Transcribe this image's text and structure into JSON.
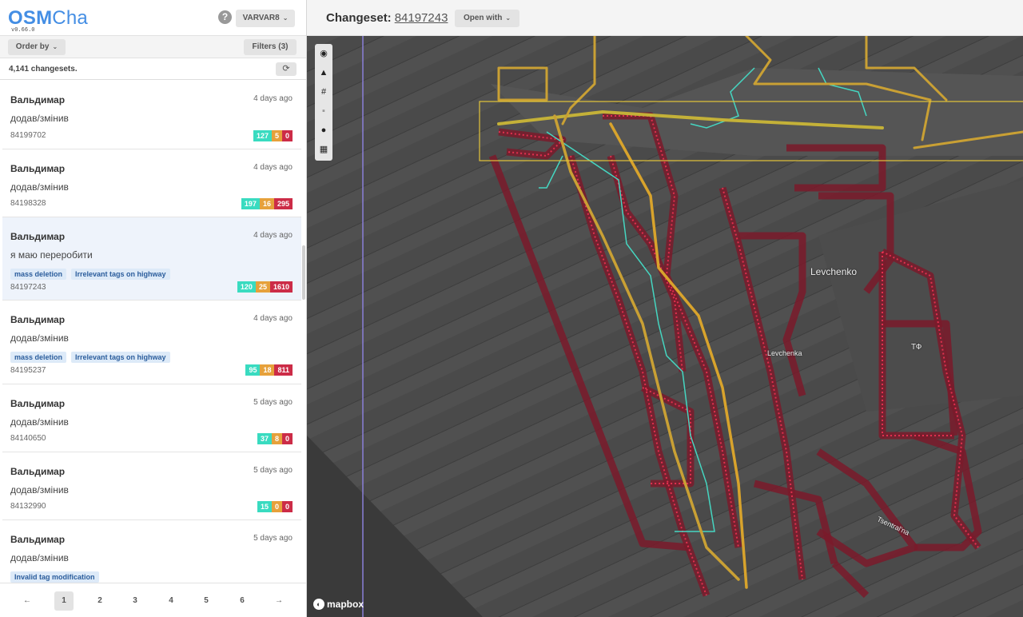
{
  "app": {
    "logo_bold": "OSM",
    "logo_rest": "Cha",
    "version": "v0.66.0",
    "user_button": "VARVAR8"
  },
  "toolbar": {
    "order_by": "Order by",
    "filters": "Filters (3)"
  },
  "list": {
    "count": "4,141 changesets.",
    "items": [
      {
        "user": "Вальдимар",
        "time": "4 days ago",
        "comment": "додав/змінив",
        "tags": [],
        "id": "84199702",
        "added": "127",
        "modified": "5",
        "deleted": "0"
      },
      {
        "user": "Вальдимар",
        "time": "4 days ago",
        "comment": "додав/змінив",
        "tags": [],
        "id": "84198328",
        "added": "197",
        "modified": "16",
        "deleted": "295"
      },
      {
        "user": "Вальдимар",
        "time": "4 days ago",
        "comment": "я маю переробити",
        "tags": [
          "mass deletion",
          "Irrelevant tags on highway"
        ],
        "id": "84197243",
        "added": "120",
        "modified": "25",
        "deleted": "1610"
      },
      {
        "user": "Вальдимар",
        "time": "4 days ago",
        "comment": "додав/змінив",
        "tags": [
          "mass deletion",
          "Irrelevant tags on highway"
        ],
        "id": "84195237",
        "added": "95",
        "modified": "18",
        "deleted": "811"
      },
      {
        "user": "Вальдимар",
        "time": "5 days ago",
        "comment": "додав/змінив",
        "tags": [],
        "id": "84140650",
        "added": "37",
        "modified": "8",
        "deleted": "0"
      },
      {
        "user": "Вальдимар",
        "time": "5 days ago",
        "comment": "додав/змінив",
        "tags": [],
        "id": "84132990",
        "added": "15",
        "modified": "0",
        "deleted": "0"
      },
      {
        "user": "Вальдимар",
        "time": "5 days ago",
        "comment": "додав/змінив",
        "tags": [
          "Invalid tag modification"
        ],
        "id": "",
        "added": "",
        "modified": "",
        "deleted": ""
      }
    ]
  },
  "pager": {
    "prev": "←",
    "next": "→",
    "pages": [
      "1",
      "2",
      "3",
      "4",
      "5",
      "6"
    ],
    "active": "1"
  },
  "changeset": {
    "label": "Changeset:",
    "id": "84197243",
    "open_with": "Open with"
  },
  "map": {
    "labels": {
      "place": "Levchenko",
      "street": "Levchenka",
      "poi": "ТФ",
      "road": "Tsentral'na"
    },
    "attribution": "mapbox",
    "tools": [
      "eye-icon",
      "warning-icon",
      "hash-icon",
      "comment-icon",
      "user-icon",
      "map-icon"
    ]
  },
  "colors": {
    "brand": "#448ee4",
    "added": "#39dbc0",
    "modified": "#e6a13b",
    "deleted": "#cc2c47",
    "selected_row": "#eef3fb"
  }
}
